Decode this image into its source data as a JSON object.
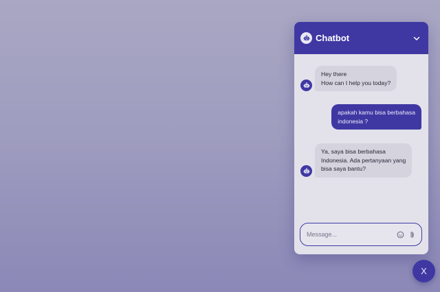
{
  "colors": {
    "accent": "#3f38a3",
    "panel": "#e3e2ea",
    "bot_bubble": "#d5d4de"
  },
  "header": {
    "title": "Chatbot",
    "avatar_icon": "robot-icon",
    "toggle_icon": "chevron-down-icon"
  },
  "messages": [
    {
      "sender": "bot",
      "lines": [
        "Hey there",
        "How can I help you today?"
      ]
    },
    {
      "sender": "user",
      "lines": [
        "apakah kamu bisa berbahasa",
        "indonesia ?"
      ]
    },
    {
      "sender": "bot",
      "lines": [
        "Ya, saya bisa berbahasa",
        "Indonesia. Ada pertanyaan yang",
        "bisa saya bantu?"
      ]
    }
  ],
  "composer": {
    "placeholder": "Message...",
    "value": "",
    "emoji_icon": "smiley-icon",
    "attach_icon": "paperclip-icon"
  },
  "close_button": {
    "label": "X"
  }
}
